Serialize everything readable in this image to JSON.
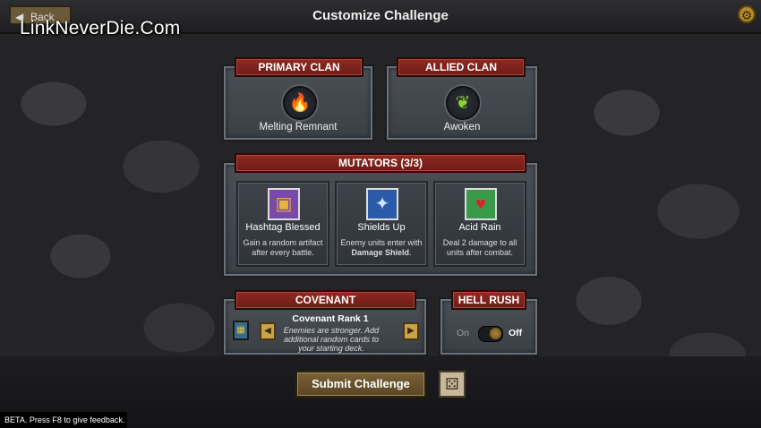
{
  "header": {
    "title": "Customize Challenge",
    "back_label": "Back",
    "back_icon": "arrow-left-icon",
    "settings_icon": "gear-icon"
  },
  "watermark": "LinkNeverDie.Com",
  "primary_clan": {
    "heading": "PRIMARY CLAN",
    "name": "Melting Remnant",
    "icon": "blue-flame-icon"
  },
  "allied_clan": {
    "heading": "ALLIED CLAN",
    "name": "Awoken",
    "icon": "green-sprout-icon"
  },
  "mutators": {
    "heading": "MUTATORS (3/3)",
    "items": [
      {
        "name": "Hashtag Blessed",
        "desc": "Gain a random artifact after every battle.",
        "icon": "treasure-chest-icon"
      },
      {
        "name": "Shields Up",
        "desc_pre": "Enemy units enter with ",
        "desc_bold": "Damage Shield",
        "desc_post": ".",
        "icon": "winged-demon-icon"
      },
      {
        "name": "Acid Rain",
        "desc": "Deal 2 damage to all units after combat.",
        "icon": "red-hearts-icon"
      }
    ]
  },
  "covenant": {
    "heading": "COVENANT",
    "rank_label": "Covenant Rank 1",
    "desc": "Enemies are stronger. Add additional random cards to your starting deck.",
    "icon": "covenant-tablet-icon"
  },
  "hell_rush": {
    "heading": "HELL RUSH",
    "on_label": "On",
    "off_label": "Off",
    "state": "Off"
  },
  "submit_label": "Submit Challenge",
  "dice_icon": "dice-icon",
  "beta_note": "BETA. Press F8 to give feedback.",
  "colors": {
    "banner_red": "#8e2a22",
    "panel_gray": "#4a4f56",
    "gold": "#c9a24a"
  }
}
